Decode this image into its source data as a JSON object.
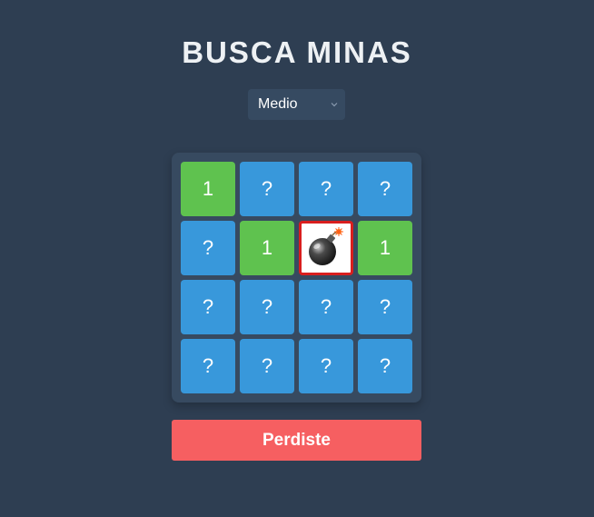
{
  "app": {
    "title": "BUSCA MINAS"
  },
  "difficulty": {
    "selected": "Medio"
  },
  "board": {
    "rows": 4,
    "cols": 4,
    "cells": [
      [
        {
          "state": "revealed",
          "label": "1"
        },
        {
          "state": "hidden",
          "label": "?"
        },
        {
          "state": "hidden",
          "label": "?"
        },
        {
          "state": "hidden",
          "label": "?"
        }
      ],
      [
        {
          "state": "hidden",
          "label": "?"
        },
        {
          "state": "revealed",
          "label": "1"
        },
        {
          "state": "mine",
          "label": "",
          "icon": "bomb-icon"
        },
        {
          "state": "revealed",
          "label": "1"
        }
      ],
      [
        {
          "state": "hidden",
          "label": "?"
        },
        {
          "state": "hidden",
          "label": "?"
        },
        {
          "state": "hidden",
          "label": "?"
        },
        {
          "state": "hidden",
          "label": "?"
        }
      ],
      [
        {
          "state": "hidden",
          "label": "?"
        },
        {
          "state": "hidden",
          "label": "?"
        },
        {
          "state": "hidden",
          "label": "?"
        },
        {
          "state": "hidden",
          "label": "?"
        }
      ]
    ]
  },
  "status": {
    "label": "Perdiste"
  },
  "colors": {
    "background": "#2e3e52",
    "hidden_cell": "#3898db",
    "revealed_cell": "#5fc24f",
    "mine_border": "#d91e1e",
    "status_button": "#f65f61"
  }
}
